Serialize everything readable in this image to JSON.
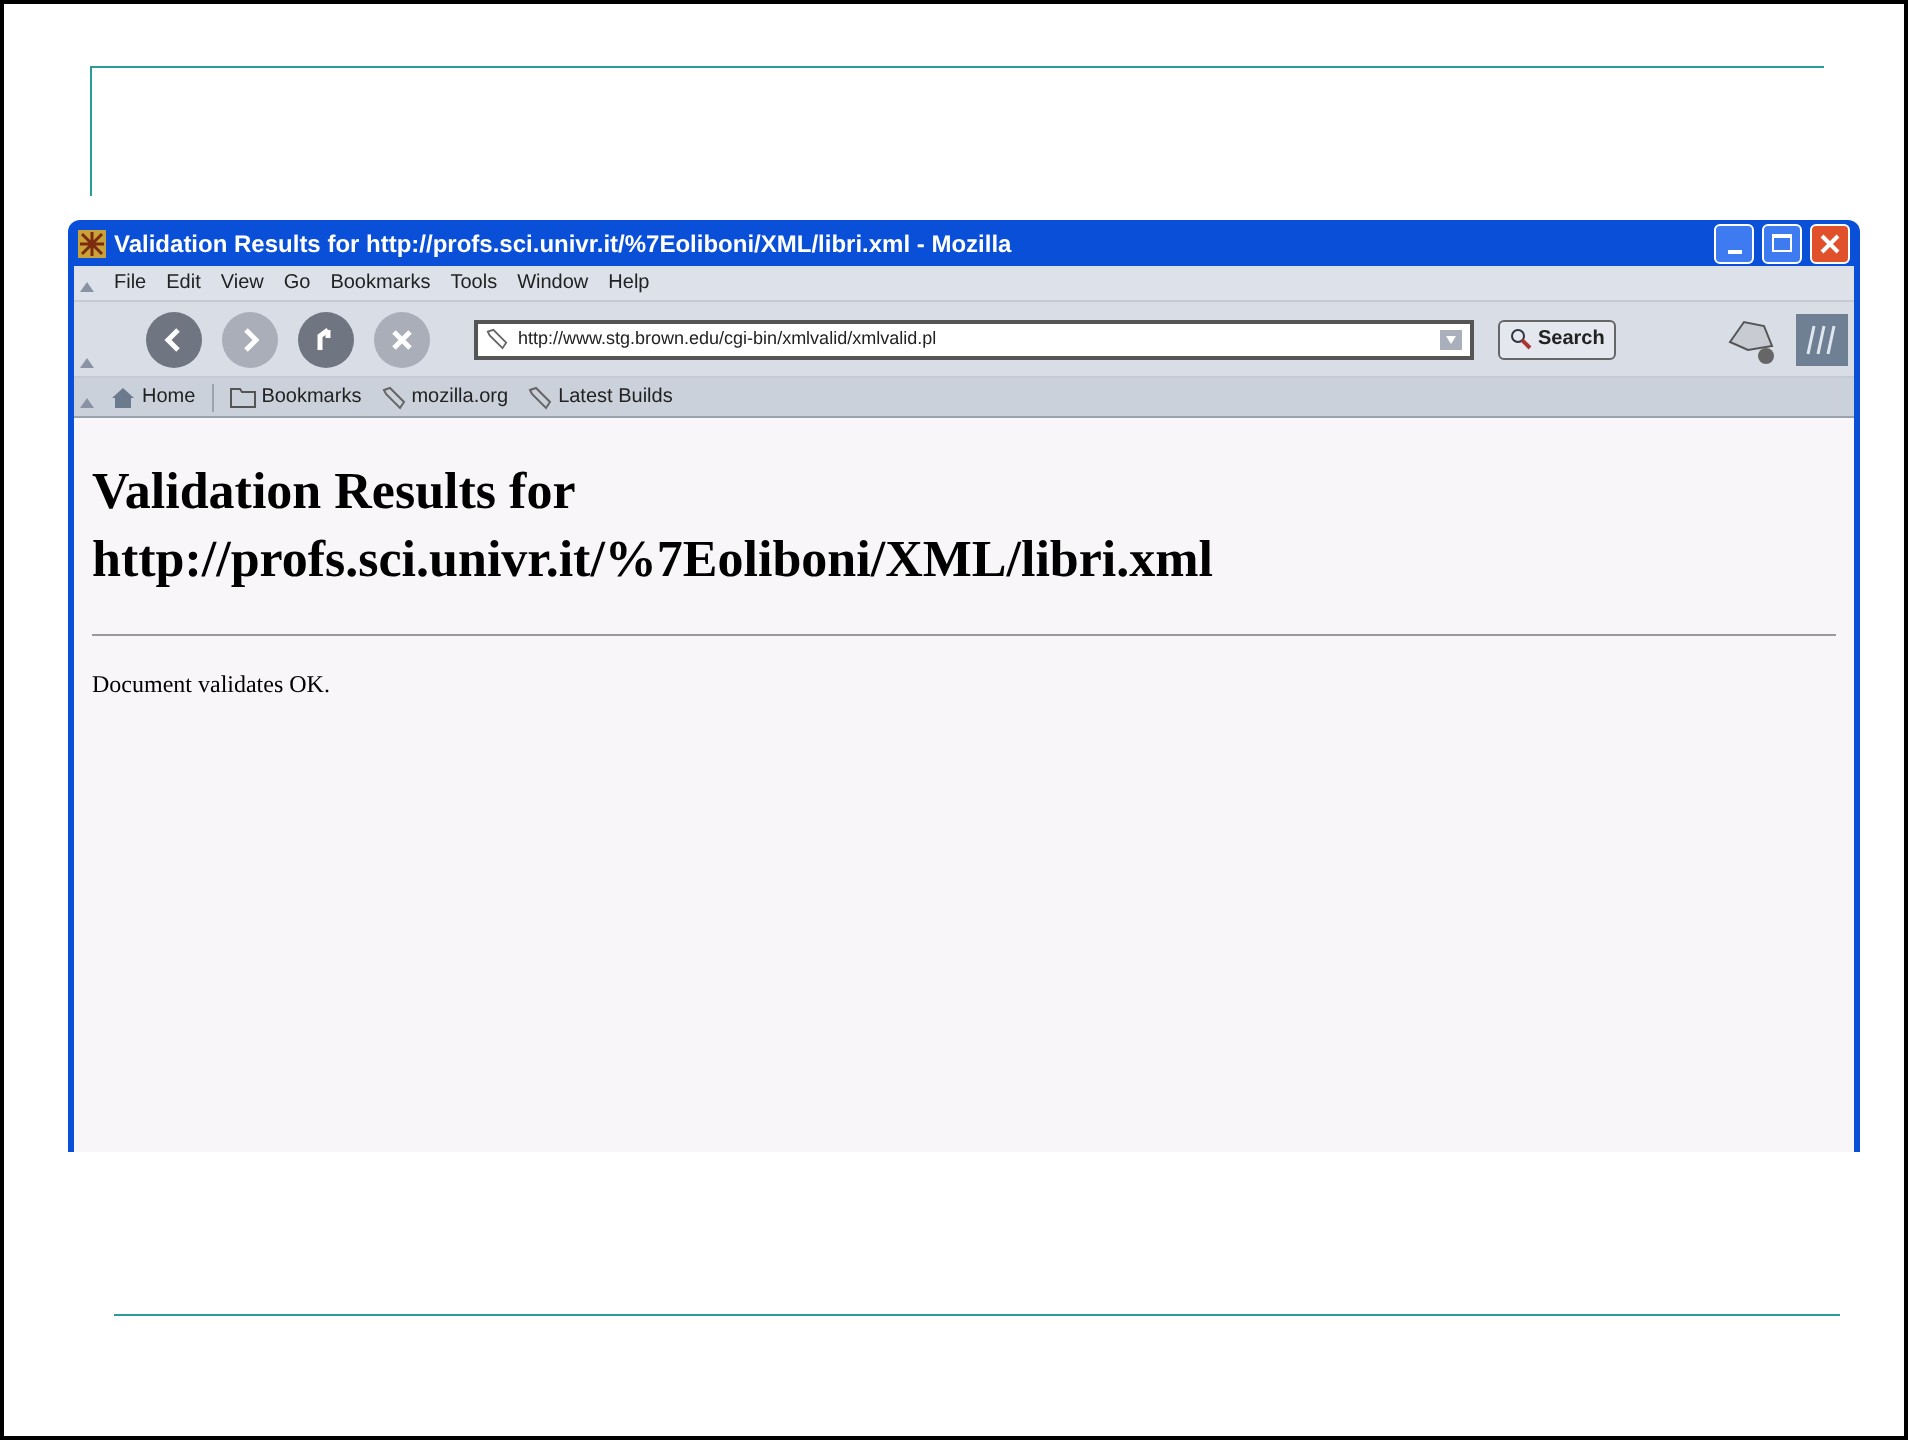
{
  "window": {
    "title": "Validation Results for http://profs.sci.univr.it/%7Eoliboni/XML/libri.xml - Mozilla"
  },
  "menu": [
    "File",
    "Edit",
    "View",
    "Go",
    "Bookmarks",
    "Tools",
    "Window",
    "Help"
  ],
  "navigation": {
    "url": "http://www.stg.brown.edu/cgi-bin/xmlvalid/xmlvalid.pl",
    "search_button": "Search"
  },
  "personal_toolbar": [
    {
      "kind": "home",
      "label": "Home"
    },
    {
      "kind": "folder",
      "label": "Bookmarks"
    },
    {
      "kind": "link",
      "label": "mozilla.org"
    },
    {
      "kind": "link",
      "label": "Latest Builds"
    }
  ],
  "page": {
    "heading": "Validation Results for http://profs.sci.univr.it/%7Eoliboni/XML/libri.xml",
    "message": "Document validates OK."
  }
}
